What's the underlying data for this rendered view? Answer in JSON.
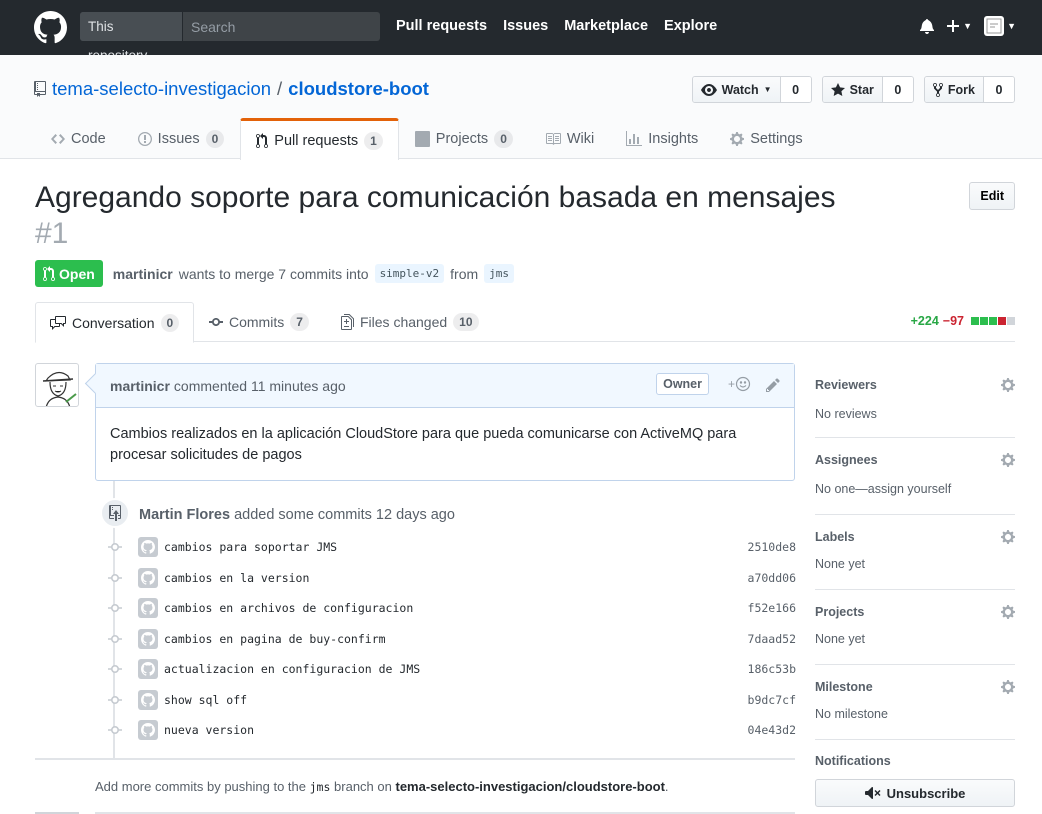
{
  "header": {
    "search_scope": "This repository",
    "search_placeholder": "Search",
    "nav": [
      "Pull requests",
      "Issues",
      "Marketplace",
      "Explore"
    ]
  },
  "repo": {
    "owner": "tema-selecto-investigacion",
    "name": "cloudstore-boot",
    "watch_label": "Watch",
    "watch_count": "0",
    "star_label": "Star",
    "star_count": "0",
    "fork_label": "Fork",
    "fork_count": "0",
    "tabs": [
      {
        "label": "Code",
        "count": ""
      },
      {
        "label": "Issues",
        "count": "0"
      },
      {
        "label": "Pull requests",
        "count": "1"
      },
      {
        "label": "Projects",
        "count": "0"
      },
      {
        "label": "Wiki",
        "count": ""
      },
      {
        "label": "Insights",
        "count": ""
      },
      {
        "label": "Settings",
        "count": ""
      }
    ]
  },
  "pr": {
    "title": "Agregando soporte para comunicación basada en mensajes",
    "number": "#1",
    "edit_label": "Edit",
    "state": "Open",
    "author": "martinicr",
    "merge_text": "wants to merge 7 commits into",
    "base_branch": "simple-v2",
    "from_text": "from",
    "head_branch": "jms",
    "tabs": [
      {
        "label": "Conversation",
        "count": "0"
      },
      {
        "label": "Commits",
        "count": "7"
      },
      {
        "label": "Files changed",
        "count": "10"
      }
    ],
    "additions": "+224",
    "deletions": "−97",
    "colors": {
      "add": "#28a745",
      "del": "#cb2431",
      "neutral": "#d1d5da",
      "open": "#2cbe4e"
    }
  },
  "comment": {
    "author": "martinicr",
    "action": "commented",
    "time": "11 minutes ago",
    "role": "Owner",
    "body": "Cambios realizados en la aplicación CloudStore para que pueda comunicarse con ActiveMQ para procesar solicitudes de pagos"
  },
  "commit_event": {
    "author": "Martin Flores",
    "text": "added some commits",
    "time": "12 days ago"
  },
  "commits": [
    {
      "message": "cambios para soportar JMS",
      "sha": "2510de8"
    },
    {
      "message": "cambios en la version",
      "sha": "a70dd06"
    },
    {
      "message": "cambios en archivos de configuracion",
      "sha": "f52e166"
    },
    {
      "message": "cambios en pagina de buy-confirm",
      "sha": "7daad52"
    },
    {
      "message": "actualizacion en configuracion de JMS",
      "sha": "186c53b"
    },
    {
      "message": "show sql off",
      "sha": "b9dc7cf"
    },
    {
      "message": "nueva version",
      "sha": "04e43d2"
    }
  ],
  "hint": {
    "prefix": "Add more commits by pushing to the",
    "branch": "jms",
    "middle": "branch on",
    "repo": "tema-selecto-investigacion/cloudstore-boot",
    "suffix": "."
  },
  "sidebar": {
    "reviewers": {
      "title": "Reviewers",
      "value": "No reviews"
    },
    "assignees": {
      "title": "Assignees",
      "value": "No one—assign yourself"
    },
    "labels": {
      "title": "Labels",
      "value": "None yet"
    },
    "projects": {
      "title": "Projects",
      "value": "None yet"
    },
    "milestone": {
      "title": "Milestone",
      "value": "No milestone"
    },
    "notifications": {
      "title": "Notifications",
      "button": "Unsubscribe"
    }
  }
}
